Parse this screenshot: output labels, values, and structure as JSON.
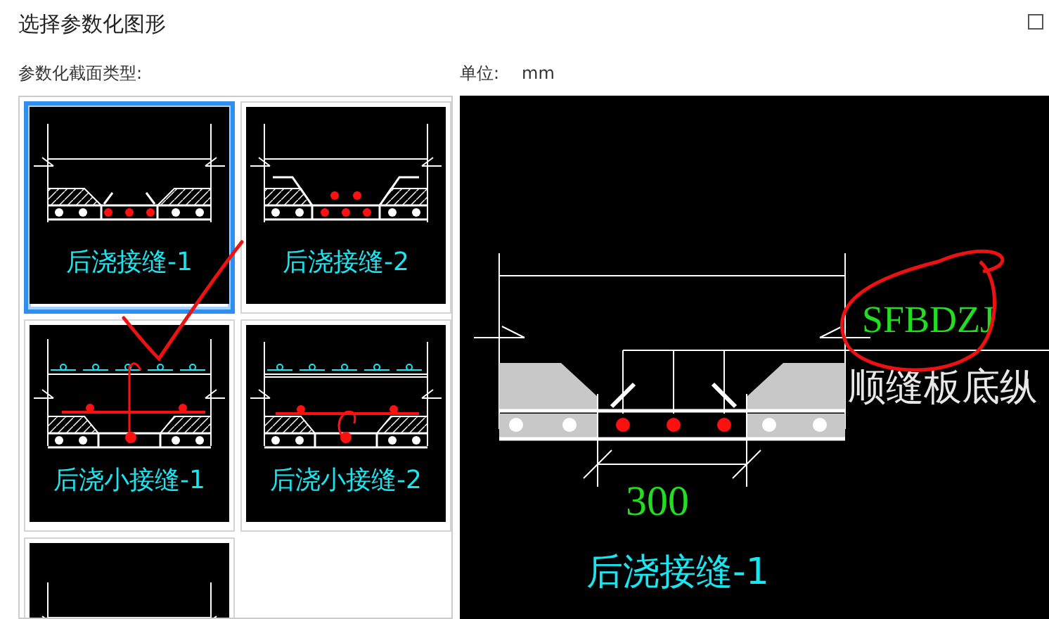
{
  "window": {
    "title": "选择参数化图形"
  },
  "section_label": "参数化截面类型:",
  "unit": {
    "label": "单位:",
    "value": "mm"
  },
  "shapes": [
    {
      "kind": "joint",
      "label": "后浇接缝-1",
      "selected": true
    },
    {
      "kind": "joint2",
      "label": "后浇接缝-2",
      "selected": false
    },
    {
      "kind": "small1",
      "label": "后浇小接缝-1",
      "selected": false
    },
    {
      "kind": "small2",
      "label": "后浇小接缝-2",
      "selected": false
    },
    {
      "kind": "partial",
      "selected": false
    }
  ],
  "preview": {
    "code": "SFBDZJ",
    "name": "顺缝板底纵",
    "dimension": "300",
    "caption": "后浇接缝-1"
  }
}
